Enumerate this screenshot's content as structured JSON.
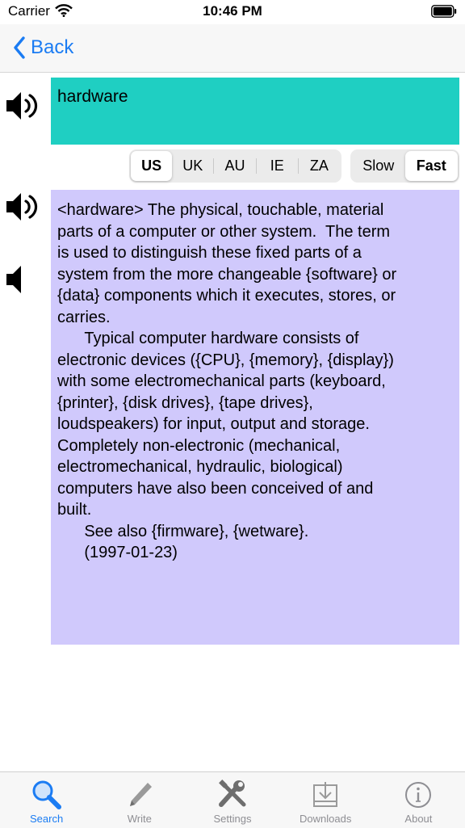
{
  "status_bar": {
    "carrier": "Carrier",
    "time": "10:46 PM"
  },
  "nav": {
    "back_label": "Back"
  },
  "entry": {
    "word": "hardware",
    "definition": "<hardware> The physical, touchable, material\nparts of a computer or other system.  The term\nis used to distinguish these fixed parts of a\nsystem from the more changeable {software} or\n{data} components which it executes, stores, or\ncarries.\n      Typical computer hardware consists of\nelectronic devices ({CPU}, {memory}, {display})\nwith some electromechanical parts (keyboard,\n{printer}, {disk drives}, {tape drives},\nloudspeakers) for input, output and storage.\nCompletely non-electronic (mechanical,\nelectromechanical, hydraulic, biological)\ncomputers have also been conceived of and\nbuilt.\n      See also {firmware}, {wetware}.\n      (1997-01-23)"
  },
  "accents": {
    "items": [
      "US",
      "UK",
      "AU",
      "IE",
      "ZA"
    ],
    "selected": "US"
  },
  "speed": {
    "items": [
      "Slow",
      "Fast"
    ],
    "selected": "Fast"
  },
  "tabs": [
    {
      "label": "Search",
      "icon": "magnifier-icon",
      "active": true
    },
    {
      "label": "Write",
      "icon": "pencil-icon",
      "active": false
    },
    {
      "label": "Settings",
      "icon": "tools-icon",
      "active": false
    },
    {
      "label": "Downloads",
      "icon": "download-tray-icon",
      "active": false
    },
    {
      "label": "About",
      "icon": "info-icon",
      "active": false
    }
  ],
  "colors": {
    "accent": "#1b7cf3",
    "word_bg": "#1fcfc2",
    "definition_bg": "#d0c9fc"
  }
}
